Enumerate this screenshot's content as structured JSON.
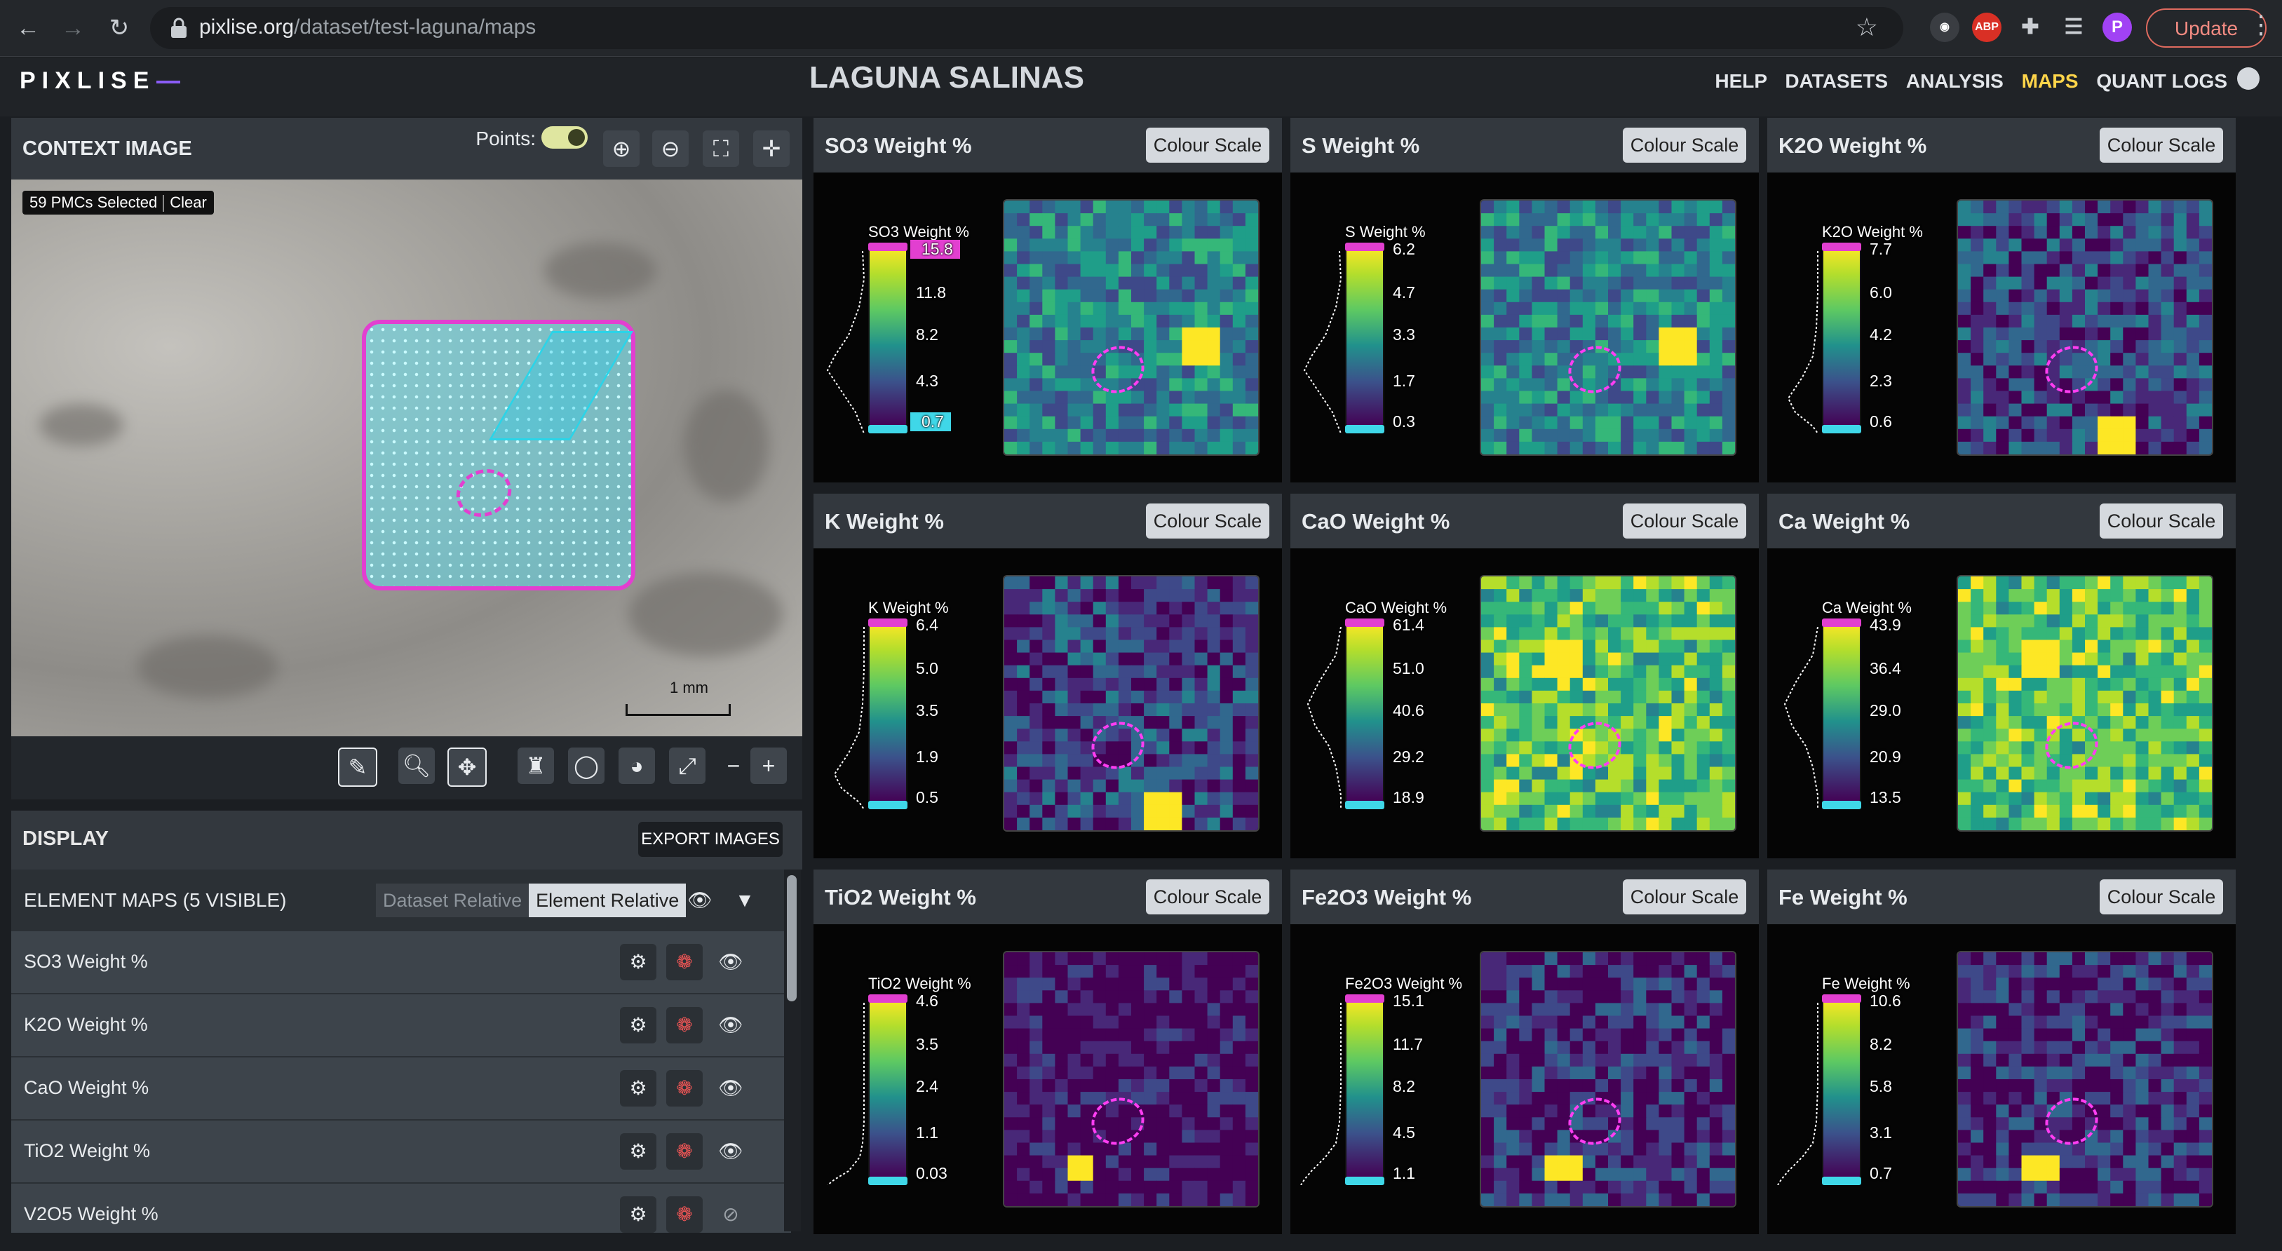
{
  "browser": {
    "url_host": "pixlise.org",
    "url_path": "/dataset/test-laguna/maps",
    "update_label": "Update",
    "profile_initial": "P",
    "abp_label": "ABP"
  },
  "app": {
    "logo": "PIXLISE",
    "title": "LAGUNA SALINAS",
    "nav": [
      "HELP",
      "DATASETS",
      "ANALYSIS",
      "MAPS",
      "QUANT LOGS"
    ],
    "active_nav": "MAPS"
  },
  "context": {
    "title": "CONTEXT IMAGE",
    "points_label": "Points:",
    "pmc_selected": "59 PMCs Selected",
    "clear_label": "Clear",
    "scale_label": "1 mm"
  },
  "display": {
    "title": "DISPLAY",
    "export_label": "EXPORT IMAGES",
    "element_maps_label": "ELEMENT MAPS (5 VISIBLE)",
    "dataset_relative": "Dataset Relative",
    "element_relative": "Element Relative",
    "rows": [
      "SO3 Weight %",
      "K2O Weight %",
      "CaO Weight %",
      "TiO2 Weight %",
      "V2O5 Weight %"
    ]
  },
  "colour_scale_label": "Colour Scale",
  "tiles": [
    {
      "title": "SO3 Weight %",
      "legend": "SO3 Weight %",
      "ticks": [
        "15.8",
        "11.8",
        "8.2",
        "4.3",
        "0.7"
      ],
      "level": 0.45,
      "spot": [
        0.75,
        0.55
      ]
    },
    {
      "title": "S Weight %",
      "legend": "S Weight %",
      "ticks": [
        "6.2",
        "4.7",
        "3.3",
        "1.7",
        "0.3"
      ],
      "level": 0.45,
      "spot": [
        0.75,
        0.55
      ]
    },
    {
      "title": "K2O Weight %",
      "legend": "K2O Weight %",
      "ticks": [
        "7.7",
        "6.0",
        "4.2",
        "2.3",
        "0.6"
      ],
      "level": 0.25,
      "spot": [
        0.6,
        0.9
      ]
    },
    {
      "title": "K Weight %",
      "legend": "K Weight %",
      "ticks": [
        "6.4",
        "5.0",
        "3.5",
        "1.9",
        "0.5"
      ],
      "level": 0.22,
      "spot": [
        0.6,
        0.9
      ]
    },
    {
      "title": "CaO Weight %",
      "legend": "CaO Weight %",
      "ticks": [
        "61.4",
        "51.0",
        "40.6",
        "29.2",
        "18.9"
      ],
      "level": 0.7,
      "spot": [
        0.3,
        0.3
      ]
    },
    {
      "title": "Ca Weight %",
      "legend": "Ca Weight %",
      "ticks": [
        "43.9",
        "36.4",
        "29.0",
        "20.9",
        "13.5"
      ],
      "level": 0.7,
      "spot": [
        0.3,
        0.3
      ]
    },
    {
      "title": "TiO2 Weight %",
      "legend": "TiO2 Weight %",
      "ticks": [
        "4.6",
        "3.5",
        "2.4",
        "1.1",
        "0.03"
      ],
      "level": 0.05,
      "spot": [
        0.28,
        0.82
      ]
    },
    {
      "title": "Fe2O3 Weight %",
      "legend": "Fe2O3 Weight %",
      "ticks": [
        "15.1",
        "11.7",
        "8.2",
        "4.5",
        "1.1"
      ],
      "level": 0.15,
      "spot": [
        0.3,
        0.82
      ]
    },
    {
      "title": "Fe Weight %",
      "legend": "Fe Weight %",
      "ticks": [
        "10.6",
        "8.2",
        "5.8",
        "3.1",
        "0.7"
      ],
      "level": 0.15,
      "spot": [
        0.3,
        0.82
      ]
    }
  ],
  "colors": {
    "accent": "#ffd54a",
    "selection": "#e23fd0",
    "pmc_points": "#64dceb"
  }
}
